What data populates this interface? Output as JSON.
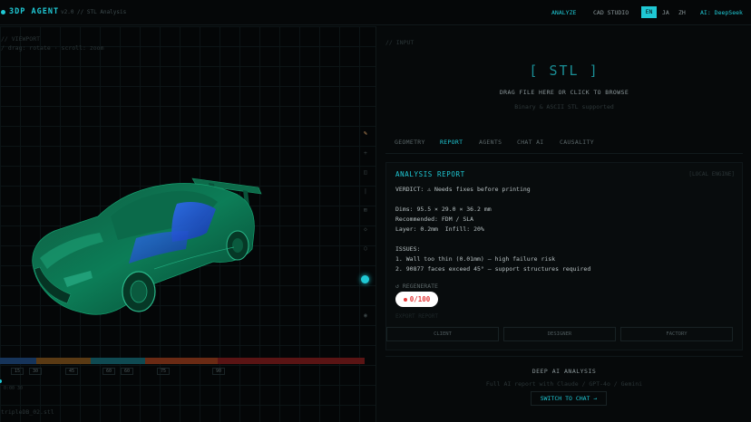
{
  "header": {
    "brand": "3DP AGENT",
    "version": "v2.0 // STL Analysis",
    "nav_analyze": "ANALYZE",
    "nav_cad": "CAD STUDIO",
    "lang_en": "EN",
    "lang_ja": "JA",
    "lang_zh": "ZH",
    "ai_label": "AI: DeepSeek"
  },
  "viewport": {
    "label": "// VIEWPORT",
    "hint": "/ drag: rotate · scroll: zoom",
    "timeline_ticks": [
      "15",
      "30",
      "45",
      "60",
      "60",
      "75",
      "90"
    ],
    "timeline_time": "0:00 30",
    "file_name": "tripleDB_02.stl",
    "tools": [
      "pen-icon",
      "plus-icon",
      "cube-icon",
      "minus-icon",
      "grid-icon",
      "layers-icon",
      "circle-icon",
      "axis-icon",
      "eye-icon"
    ]
  },
  "input": {
    "label": "// INPUT",
    "stl": "[ STL ]",
    "drop_text": "DRAG FILE HERE OR CLICK TO BROWSE",
    "drop_sub": "Binary & ASCII STL supported"
  },
  "tabs": [
    "GEOMETRY",
    "REPORT",
    "AGENTS",
    "CHAT AI",
    "CAUSALITY"
  ],
  "report": {
    "title": "ANALYSIS REPORT",
    "engine": "[LOCAL ENGINE]",
    "verdict": "VERDICT: ⚠ Needs fixes before printing",
    "dims": "Dims: 95.5 × 29.0 × 36.2 mm",
    "recommended": "Recommended: FDM / SLA",
    "layer": "Layer: 0.2mm  Infill: 20%",
    "issues_title": "ISSUES:",
    "issue_1": "1. Wall too thin (0.01mm) — high failure risk",
    "issue_2": "2. 90877 faces exceed 45° — support structures required",
    "regenerate": "↺ REGENERATE",
    "score": "0/100",
    "export_label": "EXPORT REPORT",
    "export_buttons": [
      "CLIENT",
      "DESIGNER",
      "FACTORY"
    ]
  },
  "deep": {
    "title": "DEEP AI ANALYSIS",
    "sub": "Full AI report with Claude / GPT-4o / Gemini",
    "button": "SWITCH TO CHAT →"
  },
  "colors": {
    "accent": "#1fc8d4",
    "score_red": "#e53a3a",
    "car_green": "#0e8a5e",
    "car_blue": "#1e4fd8"
  }
}
